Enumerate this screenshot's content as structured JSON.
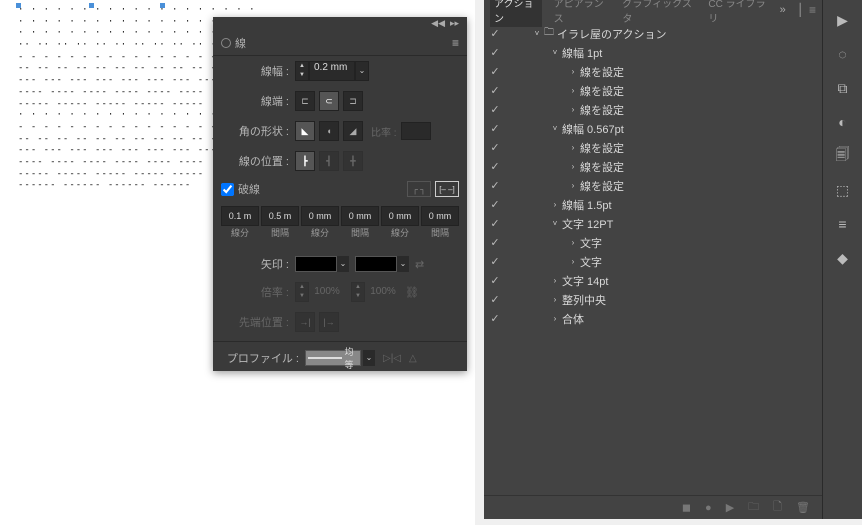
{
  "stroke_panel": {
    "title": "線",
    "weight_label": "線幅 :",
    "weight_value": "0.2 mm",
    "cap_label": "線端 :",
    "join_label": "角の形状 :",
    "limit_label": "比率 :",
    "align_label": "線の位置 :",
    "dash_check": "破線",
    "dash_values": [
      "0.1 m",
      "0.5 m",
      "0 mm",
      "0 mm",
      "0 mm",
      "0 mm"
    ],
    "dash_labels": [
      "線分",
      "間隔",
      "線分",
      "間隔",
      "線分",
      "間隔"
    ],
    "arrow_label": "矢印 :",
    "scale_label": "倍率 :",
    "scale_val": "100%",
    "tip_label": "先端位置 :",
    "profile_label": "プロファイル :",
    "profile_value": "均等"
  },
  "actions": {
    "tabs": [
      "アクション",
      "アピアランス",
      "グラフィックスタ",
      "CC ライブラリ"
    ],
    "ext": "»",
    "tree": [
      {
        "d": 0,
        "t": "set",
        "toggle": "˅",
        "icon": "folder",
        "label": "イラレ屋のアクション"
      },
      {
        "d": 1,
        "t": "action",
        "toggle": "˅",
        "label": "線幅 1pt"
      },
      {
        "d": 2,
        "t": "cmd",
        "toggle": "›",
        "label": "線を設定"
      },
      {
        "d": 2,
        "t": "cmd",
        "toggle": "›",
        "label": "線を設定"
      },
      {
        "d": 2,
        "t": "cmd",
        "toggle": "›",
        "label": "線を設定"
      },
      {
        "d": 1,
        "t": "action",
        "toggle": "˅",
        "label": "線幅 0.567pt"
      },
      {
        "d": 2,
        "t": "cmd",
        "toggle": "›",
        "label": "線を設定"
      },
      {
        "d": 2,
        "t": "cmd",
        "toggle": "›",
        "label": "線を設定"
      },
      {
        "d": 2,
        "t": "cmd",
        "toggle": "›",
        "label": "線を設定"
      },
      {
        "d": 1,
        "t": "action",
        "toggle": "›",
        "label": "線幅 1.5pt"
      },
      {
        "d": 1,
        "t": "action",
        "toggle": "˅",
        "label": "文字 12PT"
      },
      {
        "d": 2,
        "t": "cmd",
        "toggle": "›",
        "label": "文字"
      },
      {
        "d": 2,
        "t": "cmd",
        "toggle": "›",
        "label": "文字"
      },
      {
        "d": 1,
        "t": "action",
        "toggle": "›",
        "label": "文字 14pt"
      },
      {
        "d": 1,
        "t": "action",
        "toggle": "›",
        "label": "整列中央"
      },
      {
        "d": 1,
        "t": "action",
        "toggle": "›",
        "label": "合体"
      }
    ]
  },
  "rail_icons": [
    "play",
    "sun",
    "artboard",
    "cloud",
    "copy",
    "3d",
    "bars",
    "layers"
  ]
}
